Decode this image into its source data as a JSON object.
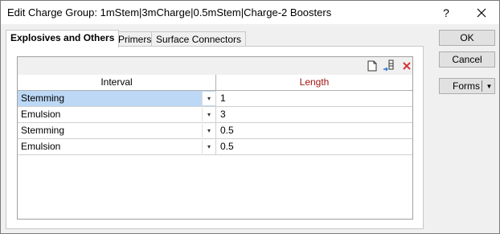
{
  "window": {
    "title": "Edit Charge Group: 1mStem|3mCharge|0.5mStem|Charge-2 Boosters",
    "help_label": "?",
    "close_label": "✕"
  },
  "tabs": [
    {
      "label": "Explosives and Others",
      "active": true
    },
    {
      "label": "Primers",
      "active": false
    },
    {
      "label": "Surface Connectors",
      "active": false
    }
  ],
  "grid": {
    "toolbar": {
      "icons": [
        "new-row-icon",
        "insert-row-icon",
        "delete-row-icon"
      ],
      "delete_color": "#d13438"
    },
    "columns": [
      "Interval",
      "Length"
    ],
    "rows": [
      {
        "interval": "Stemming",
        "length": "1",
        "selected": true
      },
      {
        "interval": "Emulsion",
        "length": "3",
        "selected": false
      },
      {
        "interval": "Stemming",
        "length": "0.5",
        "selected": false
      },
      {
        "interval": "Emulsion",
        "length": "0.5",
        "selected": false
      }
    ],
    "selection_color": "#bcd8f5",
    "length_header_color": "#a31515"
  },
  "buttons": {
    "ok": "OK",
    "cancel": "Cancel",
    "forms": "Forms"
  }
}
